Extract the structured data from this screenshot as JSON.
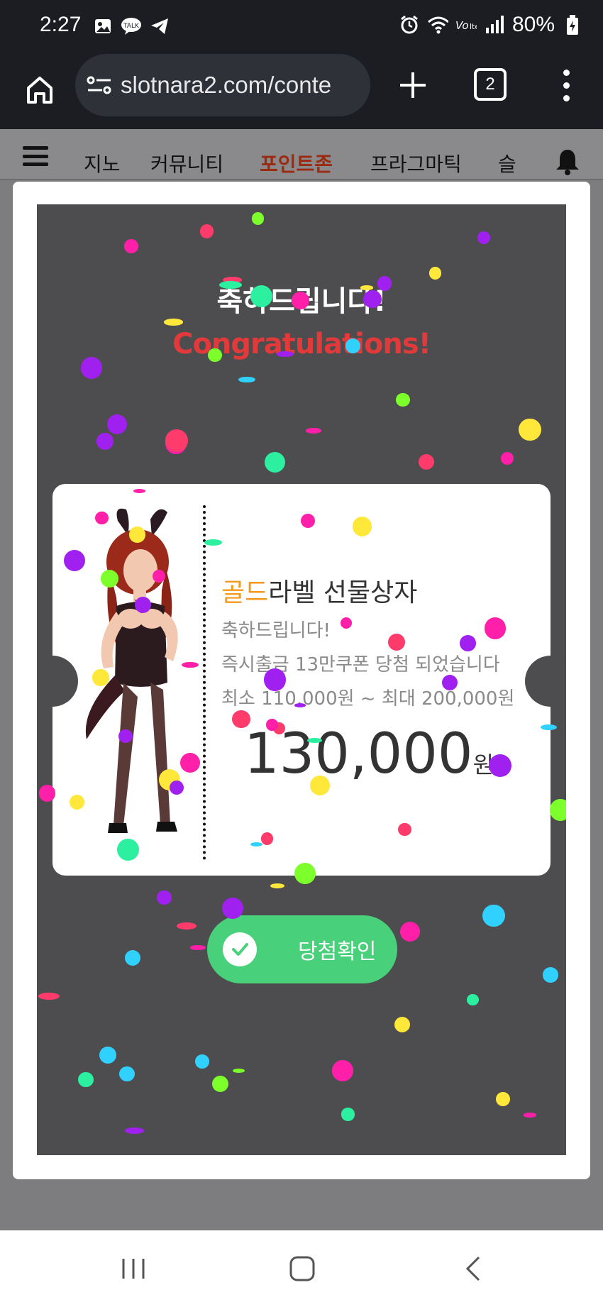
{
  "status_bar": {
    "time": "2:27",
    "battery": "80%",
    "icons": [
      "gallery-icon",
      "talk-icon",
      "telegram-icon",
      "alarm-icon",
      "wifi-icon",
      "volte-icon",
      "signal-icon",
      "battery-icon"
    ]
  },
  "browser": {
    "url": "slotnara2.com/conte",
    "tab_count": "2"
  },
  "site_nav": {
    "items": [
      "지노",
      "커뮤니티",
      "포인트존",
      "프라그마틱",
      "슬"
    ],
    "active_index": 2
  },
  "modal": {
    "title_ko": "축하드립니다!",
    "title_en": "Congratulations!",
    "gift_title_accent": "골드",
    "gift_title_rest": "라벨 선물상자",
    "line1": "축하드립니다!",
    "line2": "즉시출금 13만쿠폰 당첨 되었습니다",
    "line3": "최소 110,000원 ~ 최대 200,000원",
    "amount": "130,000",
    "amount_unit": "원",
    "confirm_label": "당첨확인"
  },
  "colors": {
    "accent_orange": "#f39a1e",
    "congrats_red": "#e23a3a",
    "confirm_green": "#49d07a",
    "nav_active": "#9b2a10"
  }
}
